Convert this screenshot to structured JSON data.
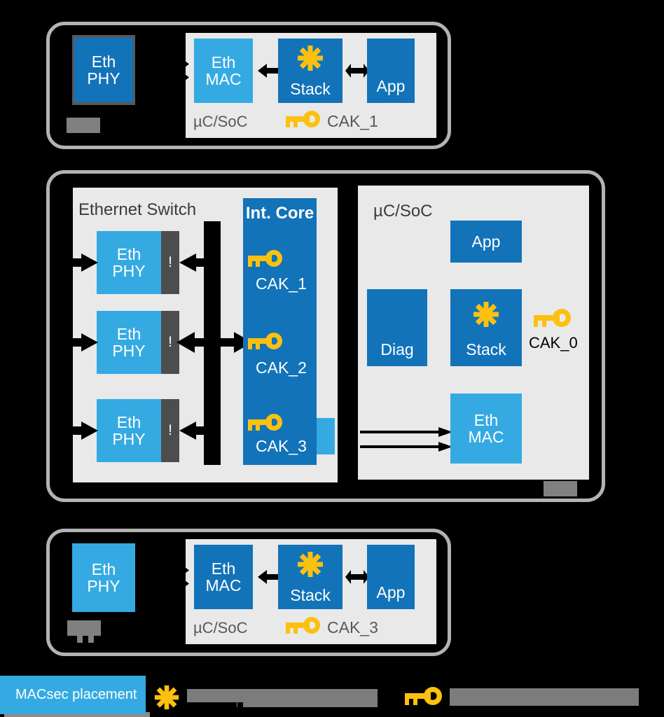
{
  "diagram": {
    "title": "MACsec placement architecture diagram",
    "colors": {
      "dark_blue": "#1273b9",
      "light_blue": "#35aae2",
      "key_yellow": "#fcc10f",
      "frame_gray": "#b3b3b3",
      "panel_gray": "#e9e9ea",
      "text_gray": "#58585a",
      "gate_gray": "#4d4d4f",
      "redact_gray": "#7c7c7c"
    },
    "sections": [
      {
        "id": "top-node",
        "phy": {
          "label_line1": "Eth",
          "label_line2": "PHY",
          "style": "dark"
        },
        "soc_label": "µC/SoC",
        "cak_label": "CAK_1",
        "blocks": [
          {
            "id": "eth-mac",
            "label_line1": "Eth",
            "label_line2": "MAC",
            "style": "light"
          },
          {
            "id": "stack",
            "label_line1": "",
            "label_line2": "Stack",
            "style": "dark",
            "icon": "star-icon"
          },
          {
            "id": "app",
            "label_line1": "",
            "label_line2": "App",
            "style": "dark"
          }
        ]
      },
      {
        "id": "middle-node",
        "switch_label": "Ethernet Switch",
        "soc_label": "µC/SoC",
        "int_core_label": "Int. Core",
        "phys": [
          {
            "label_line1": "Eth",
            "label_line2": "PHY",
            "gate": "!"
          },
          {
            "label_line1": "Eth",
            "label_line2": "PHY",
            "gate": "!"
          },
          {
            "label_line1": "Eth",
            "label_line2": "PHY",
            "gate": "!"
          }
        ],
        "core_caks": [
          "CAK_1",
          "CAK_2",
          "CAK_3"
        ],
        "soc_cak": "CAK_0",
        "soc_blocks": [
          {
            "id": "app",
            "label_line1": "",
            "label_line2": "App",
            "style": "dark"
          },
          {
            "id": "diag",
            "label_line1": "",
            "label_line2": "Diag",
            "style": "dark"
          },
          {
            "id": "stack",
            "label_line1": "",
            "label_line2": "Stack",
            "style": "dark",
            "icon": "star-icon"
          },
          {
            "id": "eth-mac",
            "label_line1": "Eth",
            "label_line2": "MAC",
            "style": "light"
          }
        ]
      },
      {
        "id": "bottom-node",
        "phy": {
          "label_line1": "Eth",
          "label_line2": "PHY",
          "style": "light"
        },
        "soc_label": "µC/SoC",
        "cak_label": "CAK_3",
        "blocks": [
          {
            "id": "eth-mac",
            "label_line1": "Eth",
            "label_line2": "MAC",
            "style": "dark"
          },
          {
            "id": "stack",
            "label_line1": "",
            "label_line2": "Stack",
            "style": "dark",
            "icon": "star-icon"
          },
          {
            "id": "app",
            "label_line1": "",
            "label_line2": "App",
            "style": "dark"
          }
        ]
      }
    ],
    "legend": {
      "placement_label": "MACsec placement",
      "star_entry_text": "",
      "key_entry_text": ""
    }
  }
}
